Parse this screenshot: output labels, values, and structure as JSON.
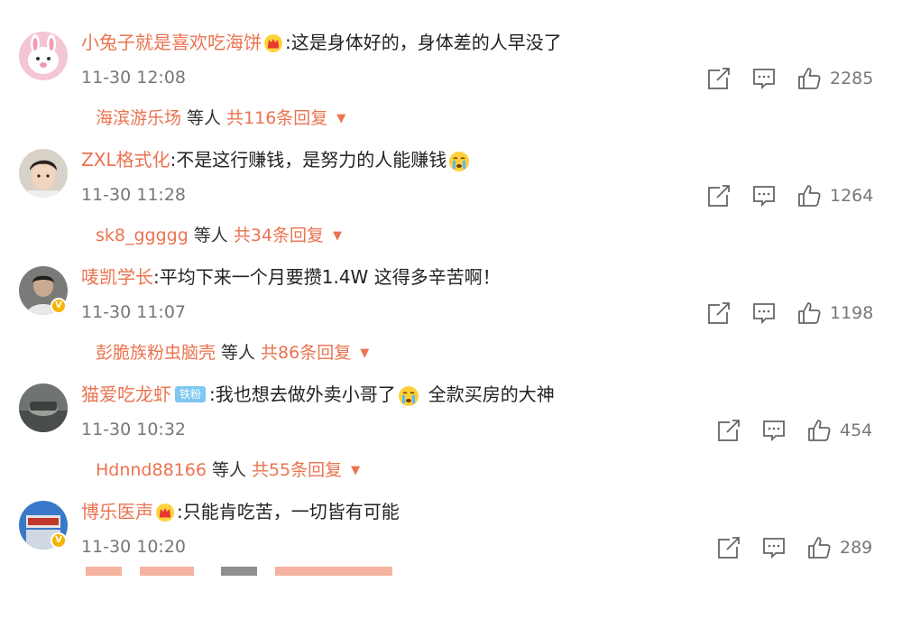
{
  "comments": [
    {
      "user": "小兔子就是喜欢吃海饼",
      "text": "这是身体好的，身体差的人早没了",
      "time": "11-30 12:08",
      "likes": "2285",
      "reply_user": "海滨游乐场",
      "reply_mid": "等人",
      "reply_count": "共116条回复",
      "badge": "crown"
    },
    {
      "user": "ZXL格式化",
      "text": "不是这行赚钱，是努力的人能赚钱",
      "time": "11-30 11:28",
      "likes": "1264",
      "reply_user": "sk8_ggggg",
      "reply_mid": "等人",
      "reply_count": "共34条回复",
      "emoji": "crying-emoji"
    },
    {
      "user": "唛凯学长",
      "text": "平均下来一个月要攒1.4W 这得多辛苦啊！",
      "time": "11-30 11:07",
      "likes": "1198",
      "reply_user": "彭脆族粉虫脑壳",
      "reply_mid": "等人",
      "reply_count": "共86条回复",
      "verified": true
    },
    {
      "user": "猫爱吃龙虾",
      "fan_badge": "铁粉",
      "text_a": "我也想去做外卖小哥了",
      "text_b": "全款买房的大神",
      "time": "11-30 10:32",
      "likes": "454",
      "reply_user": "Hdnnd88166",
      "reply_mid": "等人",
      "reply_count": "共55条回复",
      "emoji": "crying-emoji"
    },
    {
      "user": "博乐医声",
      "text": "只能肯吃苦，一切皆有可能",
      "time": "11-30 10:20",
      "likes": "289",
      "badge": "crown",
      "verified": true
    }
  ],
  "colon": ":",
  "caret": "▼",
  "vmark": "V",
  "icons": [
    "share-icon",
    "comment-icon",
    "like-icon",
    "dropdown-caret-icon",
    "crown-badge-icon"
  ],
  "colors": {
    "username": "#eb7350",
    "meta": "#777777",
    "fan_badge": "#7dc7f0"
  }
}
